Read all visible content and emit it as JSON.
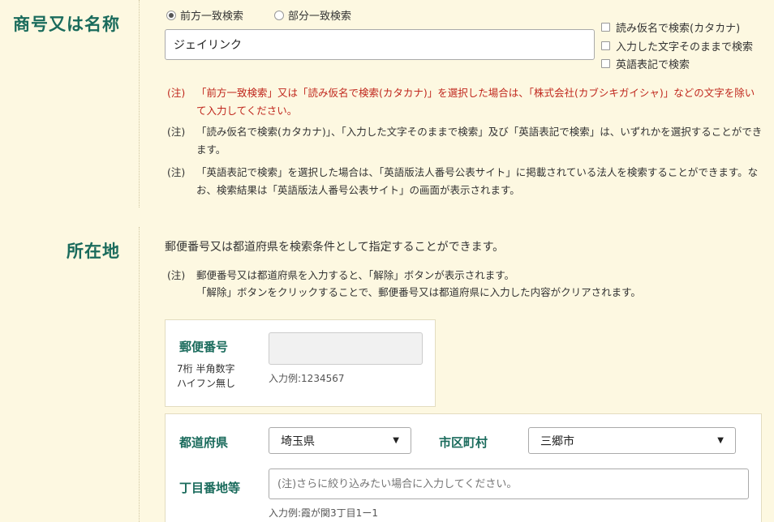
{
  "trade_name": {
    "label": "商号又は名称",
    "radio_options": [
      "前方一致検索",
      "部分一致検索"
    ],
    "selected_radio": "前方一致検索",
    "input_value": "ジェイリンク",
    "checkboxes": [
      "読み仮名で検索(カタカナ)",
      "入力した文字そのままで検索",
      "英語表記で検索"
    ],
    "notes": [
      {
        "tag": "(注)",
        "text": "「前方一致検索」又は「読み仮名で検索(カタカナ)」を選択した場合は、「株式会社(カブシキガイシャ)」などの文字を除いて入力してください。",
        "color": "#c0271d"
      },
      {
        "tag": "(注)",
        "text": "「読み仮名で検索(カタカナ)」、「入力した文字そのままで検索」及び「英語表記で検索」は、いずれかを選択することができます。",
        "color": "#333333"
      },
      {
        "tag": "(注)",
        "text": "「英語表記で検索」を選択した場合は、「英語版法人番号公表サイト」に掲載されている法人を検索することができます。なお、検索結果は「英語版法人番号公表サイト」の画面が表示されます。",
        "color": "#333333"
      }
    ]
  },
  "location": {
    "label": "所在地",
    "intro": "郵便番号又は都道府県を検索条件として指定することができます。",
    "note_tag": "(注)",
    "note_line1": "郵便番号又は都道府県を入力すると、「解除」ボタンが表示されます。",
    "note_line2": "「解除」ボタンをクリックすることで、郵便番号又は都道府県に入力した内容がクリアされます。",
    "postal": {
      "label": "郵便番号",
      "sub1": "7桁 半角数字",
      "sub2": "ハイフン無し",
      "value": "",
      "example": "入力例:1234567"
    },
    "prefecture": {
      "label": "都道府県",
      "value": "埼玉県"
    },
    "city": {
      "label": "市区町村",
      "value": "三郷市"
    },
    "chome": {
      "label": "丁目番地等",
      "placeholder": "(注)さらに絞り込みたい場合に入力してください。",
      "example": "入力例:霞が関3丁目1ー1"
    }
  },
  "colors": {
    "background": "#fdf8e1",
    "label_green": "#1a6b5c",
    "note_red": "#c0271d"
  }
}
